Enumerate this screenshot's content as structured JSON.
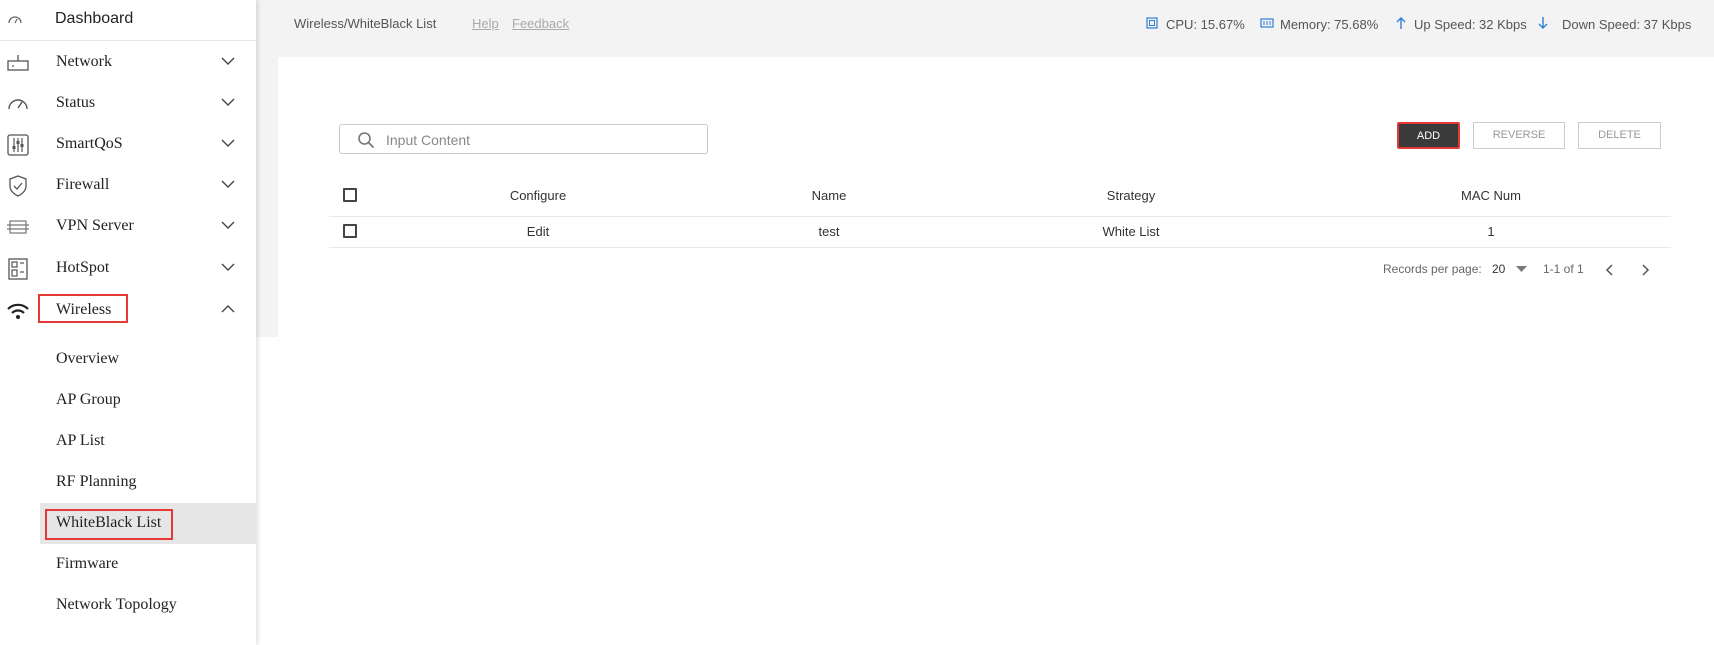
{
  "sidebar": {
    "dashboard": "Dashboard",
    "items": [
      {
        "label": "Network"
      },
      {
        "label": "Status"
      },
      {
        "label": "SmartQoS"
      },
      {
        "label": "Firewall"
      },
      {
        "label": "VPN Server"
      },
      {
        "label": "HotSpot"
      },
      {
        "label": "Wireless"
      }
    ],
    "subitems": [
      {
        "label": "Overview"
      },
      {
        "label": "AP Group"
      },
      {
        "label": "AP List"
      },
      {
        "label": "RF Planning"
      },
      {
        "label": "WhiteBlack List"
      },
      {
        "label": "Firmware"
      },
      {
        "label": "Network Topology"
      }
    ]
  },
  "header": {
    "breadcrumb": "Wireless/WhiteBlack List",
    "help": "Help",
    "feedback": "Feedback",
    "cpu": "CPU: 15.67%",
    "memory": "Memory: 75.68%",
    "up_speed": "Up Speed: 32 Kbps",
    "down_speed": "Down Speed: 37 Kbps"
  },
  "search": {
    "placeholder": "Input Content"
  },
  "toolbar": {
    "add": "ADD",
    "reverse": "REVERSE",
    "delete": "DELETE"
  },
  "table": {
    "columns": [
      "Configure",
      "Name",
      "Strategy",
      "MAC Num"
    ],
    "rows": [
      {
        "configure": "Edit",
        "name": "test",
        "strategy": "White List",
        "mac_num": "1"
      }
    ]
  },
  "pagination": {
    "records_label": "Records per page:",
    "per_page": "20",
    "range": "1-1 of 1"
  },
  "colors": {
    "accent_blue": "#2f7fd8",
    "highlight_red": "#e53935",
    "add_button": "#3a3a3a"
  }
}
